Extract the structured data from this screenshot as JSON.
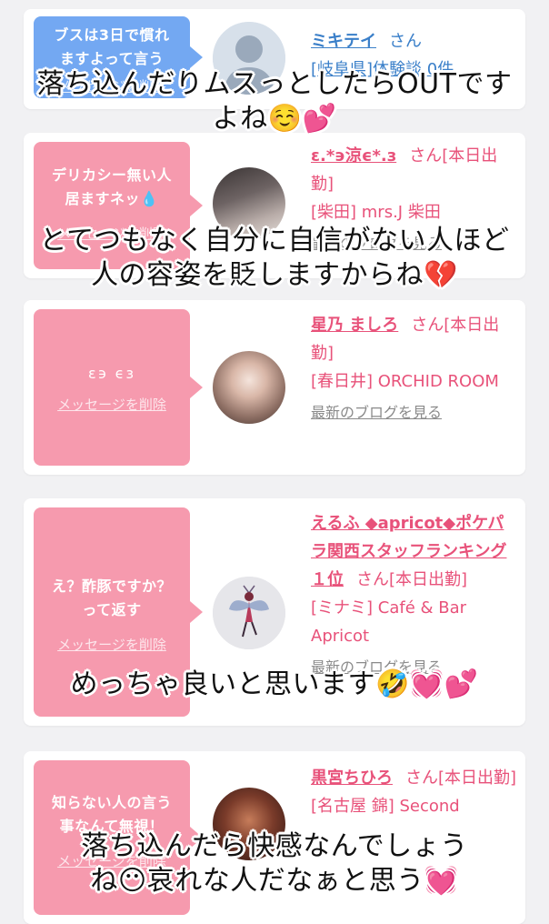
{
  "delete_label": "メッセージを削除",
  "blog_label": "最新のブログを見る",
  "san_label": "さん",
  "cards": [
    {
      "message": "ブスは3日で慣れ\nますよって言う",
      "name": "ミキテイ",
      "status": "",
      "location": "[岐阜県]体験談 0件",
      "avatar_icon": "default-user-silhouette"
    },
    {
      "message": "デリカシー無い人\n居ますネッ💧",
      "name": "ε.*϶涼ϵ*.з",
      "status": "[本日出勤]",
      "location": "[柴田] mrs.J 柴田"
    },
    {
      "message": "ε϶ ϵз",
      "name": "星乃 ましろ",
      "status": "[本日出勤]",
      "location": "[春日井] ORCHID ROOM"
    },
    {
      "message": "え？酢豚ですか？\nって返す",
      "name": "えるふ ◆apricot◆ポケパラ関西スタッフランキング１位",
      "status": "[本日出勤]",
      "location": "[ミナミ] Café & Bar Apricot",
      "avatar_icon": "fairy-icon"
    },
    {
      "message": "知らない人の言う\n事なんて無視！",
      "name": "黒宮ちひろ",
      "status": "[本日出勤]",
      "location": "[名古屋 錦] Second"
    }
  ],
  "overlays": [
    "落ち込んだりムスっとしたらOUTです\nよね☺️💕",
    "とてつもなく自分に自信がない人ほど\n人の容姿を貶しますからね💔",
    "めっちゃ良いと思います🤣💓💕",
    "落ち込んだら快感なんでしょう\nね😶哀れな人だなぁと思う💓"
  ],
  "colors": {
    "pink_bubble": "#f69aae",
    "blue_bubble": "#73a8f2",
    "name_pink": "#e8527a",
    "name_blue": "#3a7fc9"
  }
}
